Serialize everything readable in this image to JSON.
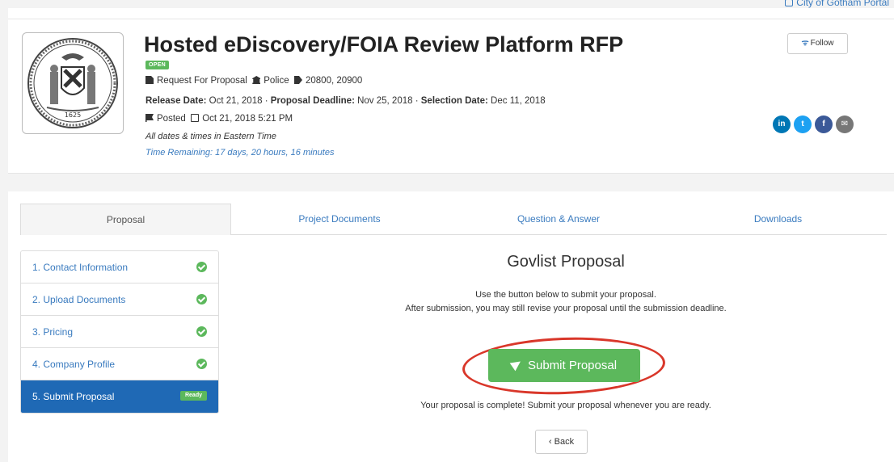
{
  "portal_link": "City of Gotham Portal",
  "header": {
    "title": "Hosted eDiscovery/FOIA Review Platform RFP",
    "status_badge": "OPEN",
    "type": "Request For Proposal",
    "department": "Police",
    "codes": "20800, 20900",
    "release_label": "Release Date:",
    "release_date": "Oct 21, 2018",
    "deadline_label": "Proposal Deadline:",
    "deadline_date": "Nov 25, 2018",
    "selection_label": "Selection Date:",
    "selection_date": "Dec 11, 2018",
    "posted_label": "Posted",
    "posted_datetime": "Oct 21, 2018 5:21 PM",
    "timezone_note": "All dates & times in Eastern Time",
    "time_remaining": "Time Remaining: 17 days, 20 hours, 16 minutes",
    "follow_label": "Follow",
    "seal_year": "1625"
  },
  "social": {
    "linkedin": "in",
    "twitter": "t",
    "facebook": "f",
    "email": "✉"
  },
  "tabs": [
    {
      "label": "Proposal"
    },
    {
      "label": "Project Documents"
    },
    {
      "label": "Question & Answer"
    },
    {
      "label": "Downloads"
    }
  ],
  "steps": [
    {
      "label": "1. Contact Information"
    },
    {
      "label": "2. Upload Documents"
    },
    {
      "label": "3. Pricing"
    },
    {
      "label": "4. Company Profile"
    },
    {
      "label": "5. Submit Proposal",
      "badge": "Ready"
    }
  ],
  "main": {
    "title": "Govlist Proposal",
    "desc_line1": "Use the button below to submit your proposal.",
    "desc_line2": "After submission, you may still revise your proposal until the submission deadline.",
    "submit_label": "Submit Proposal",
    "complete_text": "Your proposal is complete! Submit your proposal whenever you are ready.",
    "back_label": "‹ Back"
  },
  "colors": {
    "accent_blue": "#1f69b5",
    "link_blue": "#3a7bbf",
    "success_green": "#5cb85c",
    "annotation_red": "#d9372a"
  }
}
